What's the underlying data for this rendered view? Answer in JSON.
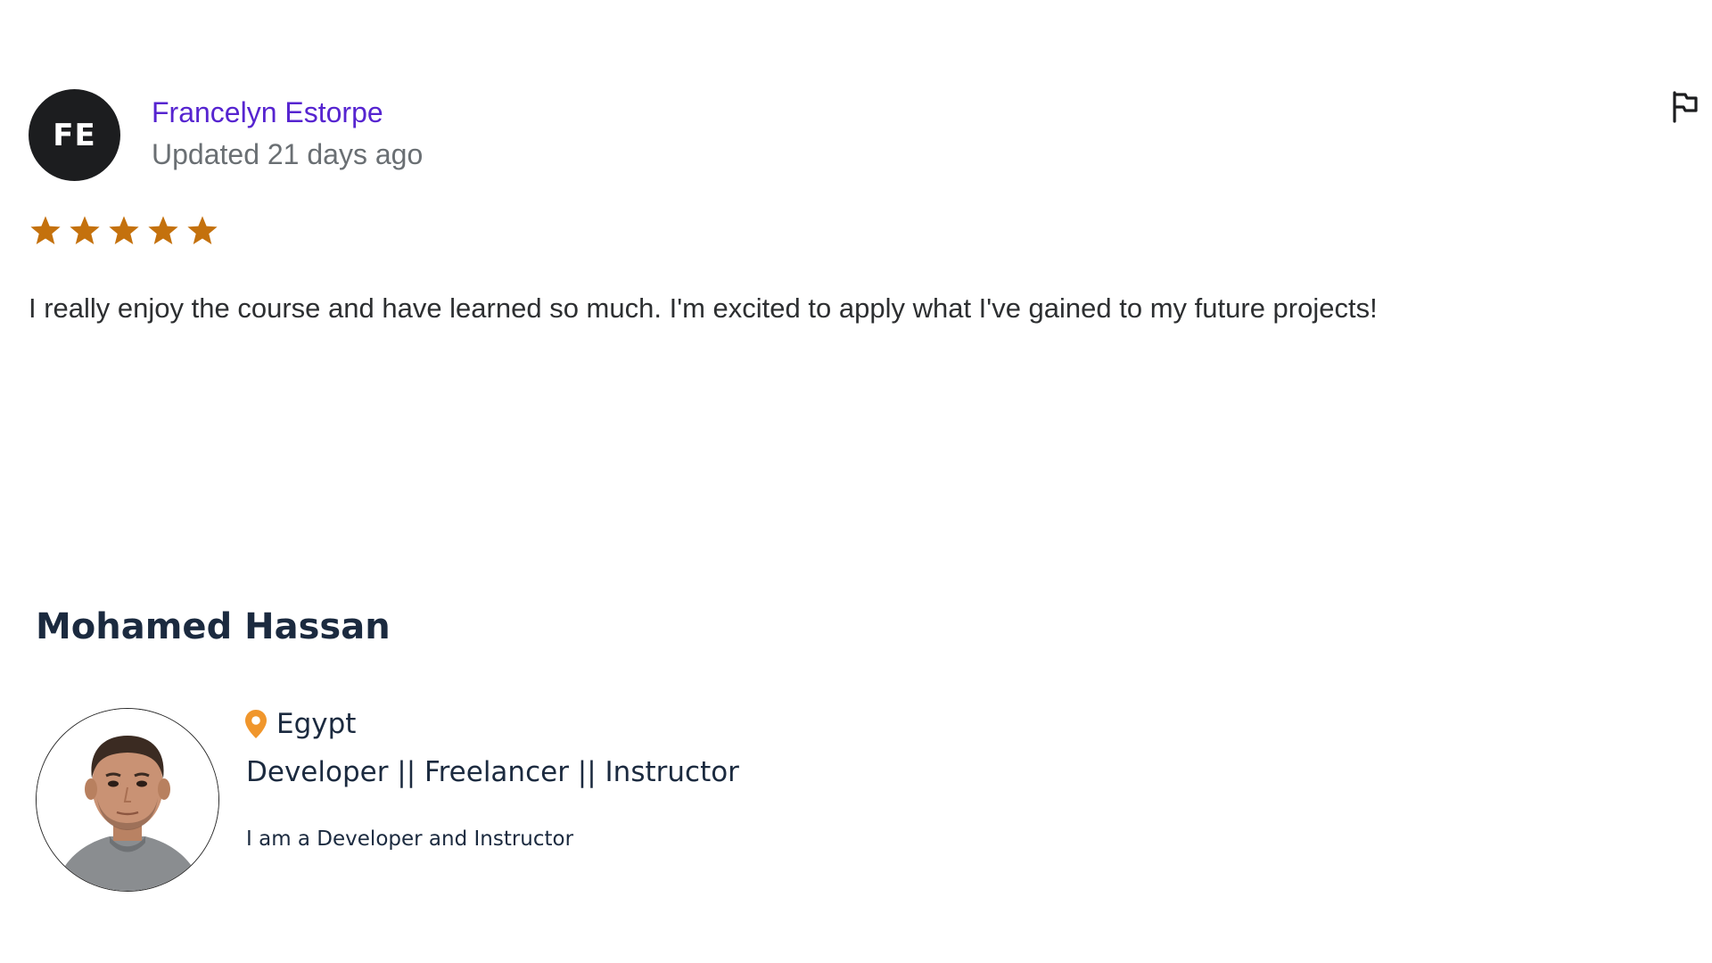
{
  "review": {
    "avatar_initials": "FE",
    "avatar_color": "#1c1d1f",
    "reviewer_name": "Francelyn Estorpe",
    "reviewer_name_color": "#5624d0",
    "date_text": "Updated 21 days ago",
    "rating": 5,
    "rating_max": 5,
    "star_color": "#c4710d",
    "text": "I really enjoy the course and have learned so much. I'm excited to apply what I've gained to my future projects!",
    "report_icon": "flag-icon"
  },
  "instructor": {
    "name": "Mohamed Hassan",
    "location": "Egypt",
    "location_icon": "map-pin-icon",
    "pin_color": "#f0962c",
    "headline": "Developer || Freelancer || Instructor",
    "bio": "I am a Developer and Instructor"
  }
}
